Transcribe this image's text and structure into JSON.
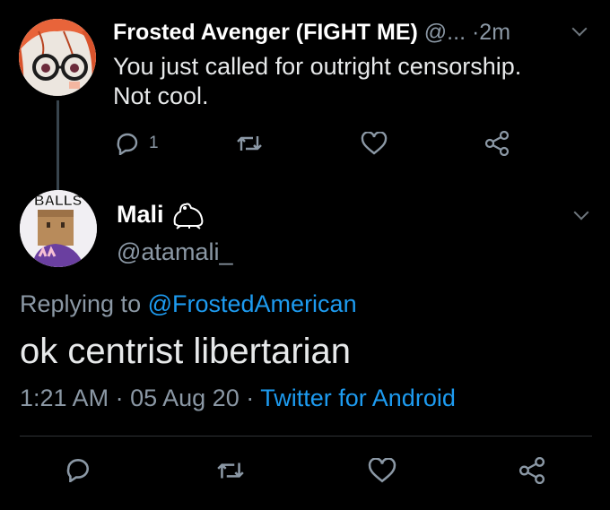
{
  "tweet1": {
    "display_name": "Frosted Avenger (FIGHT ME)",
    "handle_truncated": "@...",
    "separator": "·",
    "time": "2m",
    "text_line1": "You just called for outright censorship.",
    "text_line2": "Not cool.",
    "reply_count": "1"
  },
  "tweet2": {
    "display_name": "Mali",
    "handle": "@atamali_",
    "avatar_text": "BALLS",
    "replying_prefix": "Replying to",
    "replying_to": "@FrostedAmerican",
    "text": "ok centrist libertarian",
    "time": "1:21 AM",
    "date": "05 Aug 20",
    "client": "Twitter for Android",
    "separator": "·"
  },
  "colors": {
    "background": "#000000",
    "muted": "#8b98a5",
    "link": "#1d9bf0",
    "divider": "#2f3336"
  },
  "icons": [
    "reply-icon",
    "retweet-icon",
    "like-icon",
    "share-icon",
    "chevron-down-icon",
    "frog-icon"
  ]
}
